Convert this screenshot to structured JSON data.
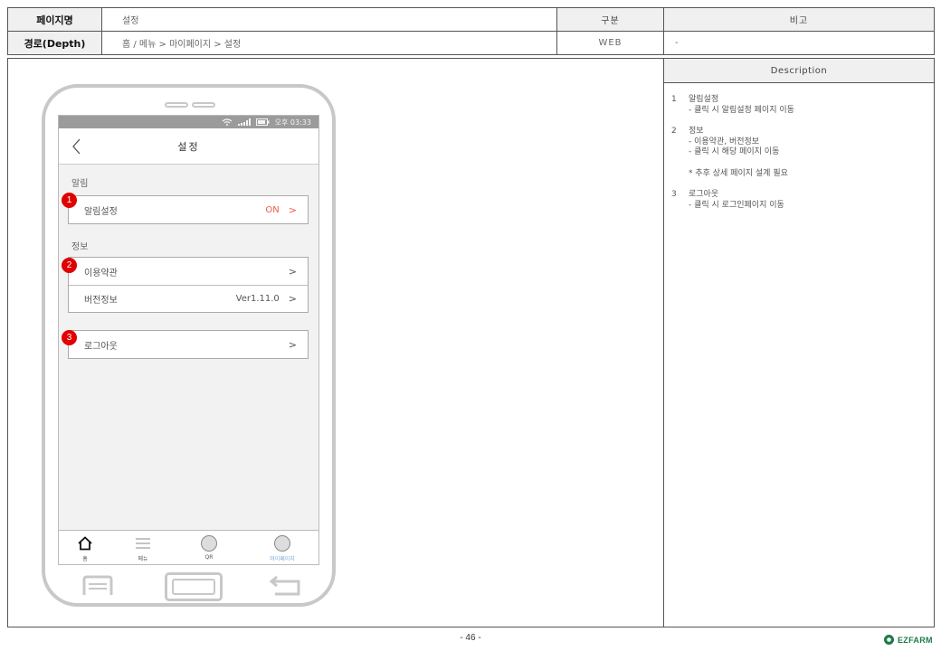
{
  "header": {
    "page_name_label": "페이지명",
    "page_name_value": "설정",
    "depth_label": "경로(Depth)",
    "depth_value": "홈 / 메뉴 > 마이페이지 > 설정",
    "division_label": "구분",
    "division_value": "WEB",
    "note_label": "비고",
    "note_value": "-"
  },
  "description": {
    "title": "Description",
    "items": [
      {
        "num": "1",
        "title": "알림설정",
        "lines": [
          "- 클릭 시 알림설정 페이지 이동"
        ]
      },
      {
        "num": "2",
        "title": "정보",
        "lines": [
          "- 이용약관, 버전정보",
          "- 클릭 시 해당 페이지 이동"
        ],
        "note": "* 추후 상세 페이지 설계 필요"
      },
      {
        "num": "3",
        "title": "로그아웃",
        "lines": [
          "- 클릭 시 로그인페이지 이동"
        ]
      }
    ]
  },
  "phone": {
    "status_time": "오후 03:33",
    "app_title": "설정",
    "section_alarm": "알림",
    "alarm_row": {
      "label": "알림설정",
      "value": "ON",
      "chevron": ">"
    },
    "section_info": "정보",
    "terms_row": {
      "label": "이용약관",
      "chevron": ">"
    },
    "version_row": {
      "label": "버전정보",
      "value": "Ver1.11.0",
      "chevron": ">"
    },
    "logout_row": {
      "label": "로그아웃",
      "chevron": ">"
    },
    "badges": [
      "1",
      "2",
      "3"
    ],
    "tabs": [
      {
        "label": "홈",
        "icon": "home-icon"
      },
      {
        "label": "메뉴",
        "icon": "menu-icon"
      },
      {
        "label": "QR",
        "icon": "qr-icon"
      },
      {
        "label": "마이페이지",
        "icon": "mypage-icon"
      }
    ]
  },
  "footer": {
    "page_number": "- 46 -",
    "logo_text": "EZFARM"
  },
  "colors": {
    "accent_on": "#f05a4a",
    "badge": "#e00000",
    "active_tab": "#7aa9d8",
    "logo": "#1f7a4a"
  }
}
